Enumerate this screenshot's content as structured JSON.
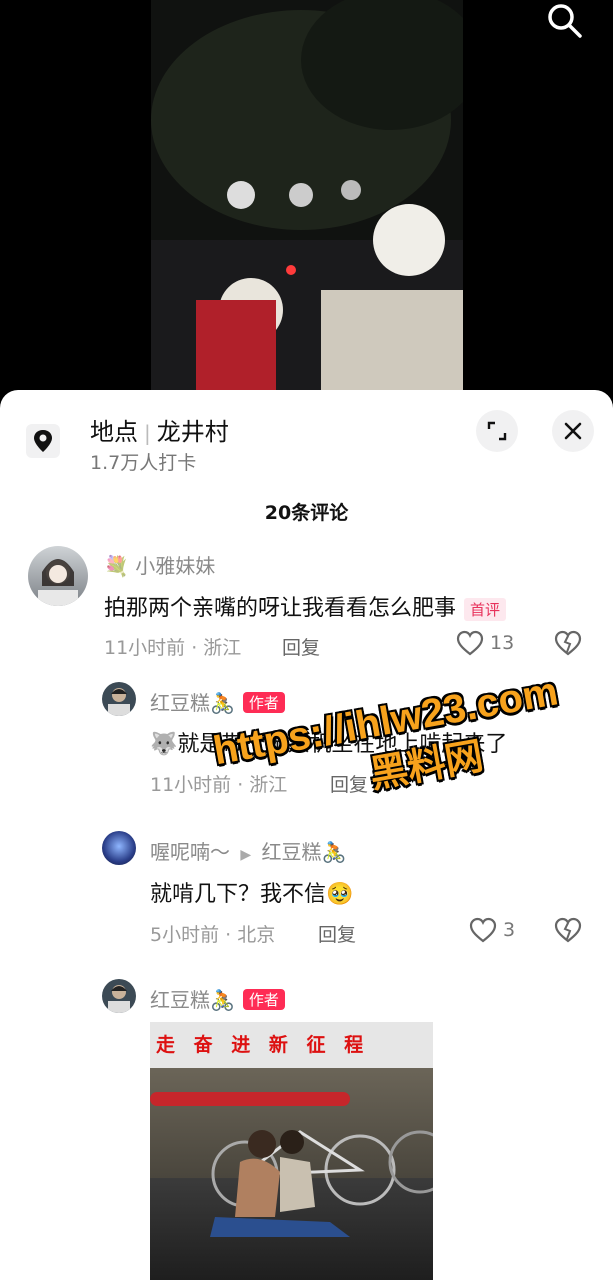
{
  "video": {
    "search_icon": "search-icon"
  },
  "location": {
    "label": "地点",
    "name": "龙井村",
    "checkins": "1.7万人打卡",
    "expand_icon": "expand-icon",
    "close_icon": "close-icon"
  },
  "comments_count": "20条评论",
  "comments": [
    {
      "user": "小雅妹妹",
      "prefix_emoji": "💐",
      "text": "拍那两个亲嘴的呀让我看看怎么肥事",
      "badge": "首评",
      "time": "11小时前 · 浙江",
      "reply_label": "回复",
      "likes": "13"
    }
  ],
  "replies": [
    {
      "user": "红豆糕🚴",
      "badge": "作者",
      "text": "🐺就是带个无人机坐在地上啃起来了",
      "time": "11小时前 · 浙江",
      "reply_label": "回复"
    },
    {
      "user": "喔呢喃～",
      "reply_to": "红豆糕🚴",
      "text": "就啃几下？我不信🥹",
      "time": "5小时前 · 北京",
      "reply_label": "回复",
      "likes": "3"
    },
    {
      "user": "红豆糕🚴",
      "badge": "作者",
      "photo_banner": "走 奋 进 新 征 程"
    }
  ],
  "watermark": {
    "url": "https://ihlw23.com",
    "sub": "黑料网"
  },
  "colors": {
    "accent": "#fe2c55",
    "watermark": "#f7a21c"
  }
}
